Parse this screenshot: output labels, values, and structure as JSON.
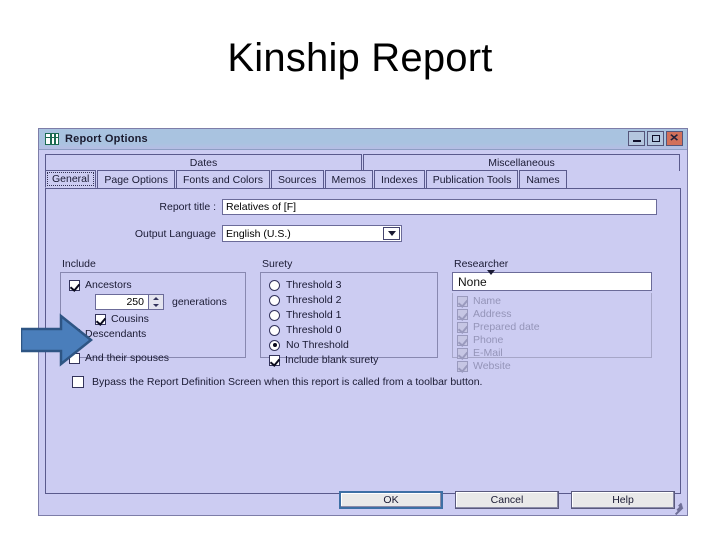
{
  "slide": {
    "title": "Kinship Report"
  },
  "window": {
    "title": "Report Options",
    "icon": "grid-table-icon",
    "controls": {
      "minimize": "–",
      "maximize": "□",
      "close": "✕"
    }
  },
  "tabs": {
    "top_row": [
      {
        "label": "Dates"
      },
      {
        "label": "Miscellaneous"
      }
    ],
    "bottom_row": [
      {
        "label": "General",
        "selected": true
      },
      {
        "label": "Page Options",
        "selected": false
      },
      {
        "label": "Fonts and Colors",
        "selected": false
      },
      {
        "label": "Sources",
        "selected": false
      },
      {
        "label": "Memos",
        "selected": false
      },
      {
        "label": "Indexes",
        "selected": false
      },
      {
        "label": "Publication Tools",
        "selected": false
      },
      {
        "label": "Names",
        "selected": false
      }
    ]
  },
  "form": {
    "report_title_label": "Report title :",
    "report_title_value": "Relatives of [F]",
    "output_language_label": "Output Language",
    "output_language_value": "English (U.S.)"
  },
  "include": {
    "title": "Include",
    "items": [
      {
        "label": "Ancestors",
        "checked": true
      },
      {
        "label": "Cousins",
        "checked": true
      },
      {
        "label": "Descendants",
        "checked": false
      },
      {
        "label": "And their spouses",
        "checked": false
      }
    ],
    "generations": {
      "value": "250",
      "unit": "generations"
    }
  },
  "surety": {
    "title": "Surety",
    "options": [
      {
        "label": "Threshold 3",
        "selected": false
      },
      {
        "label": "Threshold 2",
        "selected": false
      },
      {
        "label": "Threshold 1",
        "selected": false
      },
      {
        "label": "Threshold 0",
        "selected": false
      },
      {
        "label": "No Threshold",
        "selected": true
      }
    ],
    "include_blank": {
      "label": "Include blank surety",
      "checked": true
    }
  },
  "researcher": {
    "title": "Researcher",
    "selected": "None",
    "fields": [
      {
        "label": "Name",
        "checked": true,
        "disabled": true
      },
      {
        "label": "Address",
        "checked": true,
        "disabled": true
      },
      {
        "label": "Prepared date",
        "checked": true,
        "disabled": true
      },
      {
        "label": "Phone",
        "checked": true,
        "disabled": true
      },
      {
        "label": "E-Mail",
        "checked": true,
        "disabled": true
      },
      {
        "label": "Website",
        "checked": true,
        "disabled": true
      }
    ]
  },
  "bypass": {
    "label": "Bypass the Report Definition Screen when this report is called from a toolbar button.",
    "checked": false
  },
  "buttons": {
    "ok": "OK",
    "cancel": "Cancel",
    "help": "Help"
  },
  "annotation": {
    "arrow": "right-arrow-callout",
    "fill": "#4a7ebb",
    "stroke": "#2e5584"
  }
}
